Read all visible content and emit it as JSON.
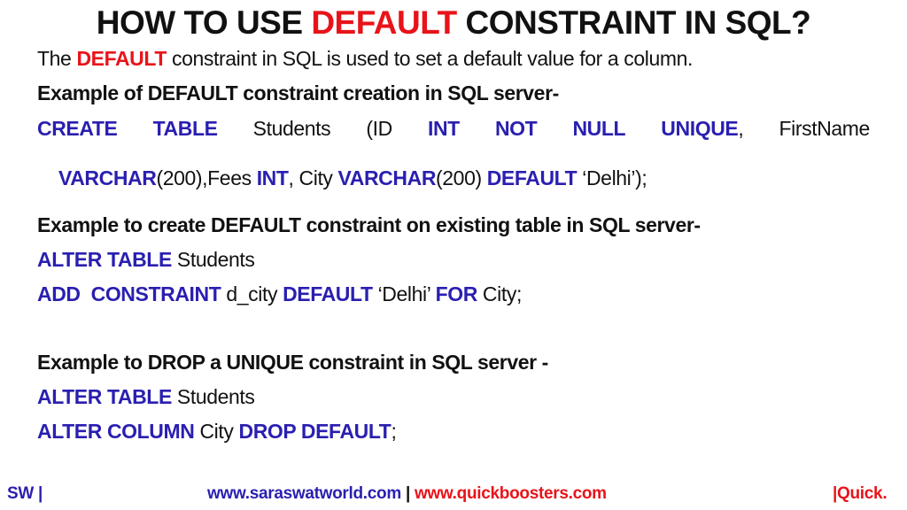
{
  "title": {
    "pre": "HOW TO USE ",
    "highlight": "DEFAULT",
    "post": " CONSTRAINT IN SQL?"
  },
  "intro": {
    "pre": "The ",
    "highlight": "DEFAULT",
    "post": " constraint in SQL is used to set a default value for a column."
  },
  "section1": {
    "heading": "Example of DEFAULT constraint creation in SQL server-",
    "row1": [
      "CREATE",
      "TABLE",
      "Students",
      "(ID",
      "INT",
      "NOT",
      "NULL",
      "UNIQUE",
      ",",
      "FirstName"
    ],
    "row2": [
      "VARCHAR",
      "(200),Fees ",
      "INT",
      ", City ",
      "VARCHAR",
      "(200) ",
      "DEFAULT",
      " ‘Delhi’);"
    ]
  },
  "section2": {
    "heading": "Example to create DEFAULT constraint on existing table in SQL server-",
    "line1": [
      "ALTER TABLE",
      " Students"
    ],
    "line2": [
      "ADD  CONSTRAINT",
      " d_city ",
      "DEFAULT",
      " ‘Delhi’ ",
      "FOR",
      " City;"
    ]
  },
  "section3": {
    "heading": "Example to DROP a UNIQUE constraint in SQL server -",
    "line1": [
      "ALTER TABLE",
      " Students"
    ],
    "line2": [
      "ALTER COLUMN",
      " City ",
      "DROP DEFAULT",
      ";"
    ]
  },
  "footer": {
    "left": "SW |",
    "link1": "www.saraswatworld.com",
    "separator": " | ",
    "link2": "www.quickboosters.com",
    "right": "|Quick."
  },
  "colors": {
    "keyword": "#2a1fb0",
    "highlight": "#e8131a",
    "text": "#111111"
  }
}
